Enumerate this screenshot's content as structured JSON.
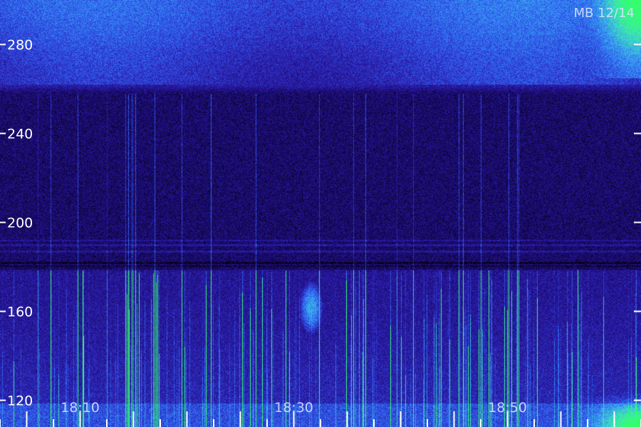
{
  "corner_label": "MB 12/14",
  "chart_data": {
    "type": "heatmap",
    "title": "",
    "xlabel": "",
    "ylabel": "",
    "y_ticks": [
      120,
      160,
      200,
      240,
      280
    ],
    "ylim": [
      108,
      300
    ],
    "x_tick_labels": [
      "18:10",
      "18:30",
      "18:50"
    ],
    "x_tick_times_min": [
      10,
      30,
      50
    ],
    "xlim_min": [
      2.5,
      62.5
    ],
    "colormap": [
      "#000000",
      "#1a0a6e",
      "#2d1fb0",
      "#2f5ff0",
      "#3aa8f0",
      "#3de8b0",
      "#34ff6a"
    ],
    "background_color": "#0b0540",
    "tick_color": "#ffffff",
    "features": {
      "bright_band_freq": [
        262,
        300
      ],
      "dark_band_freq": [
        180,
        258
      ],
      "horizontal_lines_freq": [
        187,
        190,
        192,
        182
      ],
      "active_region_freq": [
        108,
        178
      ],
      "burst_time_min": 31.6,
      "burst_freq": [
        152,
        172
      ],
      "hot_corner_top_right": {
        "time_min": [
          57,
          62.5
        ],
        "freq": [
          265,
          300
        ]
      },
      "hot_corner_bottom_right": {
        "time_min": [
          56,
          62.5
        ],
        "freq": [
          108,
          125
        ]
      }
    }
  }
}
